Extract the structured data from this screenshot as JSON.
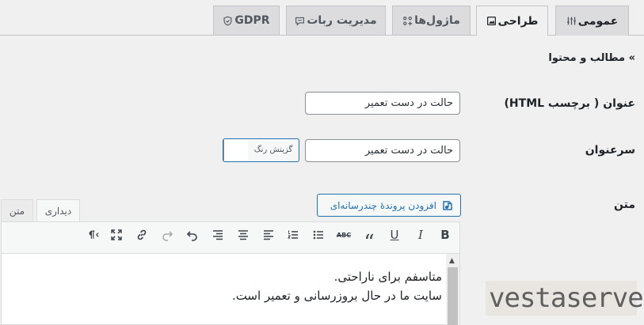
{
  "tabs": [
    {
      "label": "عمومی",
      "icon": "sliders-icon"
    },
    {
      "label": "طراحی",
      "icon": "image-icon"
    },
    {
      "label": "ماژول‌ها",
      "icon": "modules-icon"
    },
    {
      "label": "مدیریت ربات",
      "icon": "chat-icon"
    },
    {
      "label": "GDPR",
      "icon": "shield-icon"
    }
  ],
  "section_heading": "» مطالب و محتوا",
  "fields": {
    "title_label": "عنوان ( برچسب HTML)",
    "title_value": "حالت در دست تعمیر",
    "heading_label": "سرعنوان",
    "heading_value": "حالت در دست تعمیر",
    "color_button": "گزینش رنگ",
    "text_label": "متن"
  },
  "editor": {
    "add_media": "افزودن پروندهٔ چندرسانه‌ای",
    "tab_visual": "دیداری",
    "tab_text": "متن",
    "line1": "متاسفم برای ناراحتی.",
    "line2": "سایت ما در حال بروزرسانی و تعمیر است."
  },
  "watermark": "vestaserver"
}
